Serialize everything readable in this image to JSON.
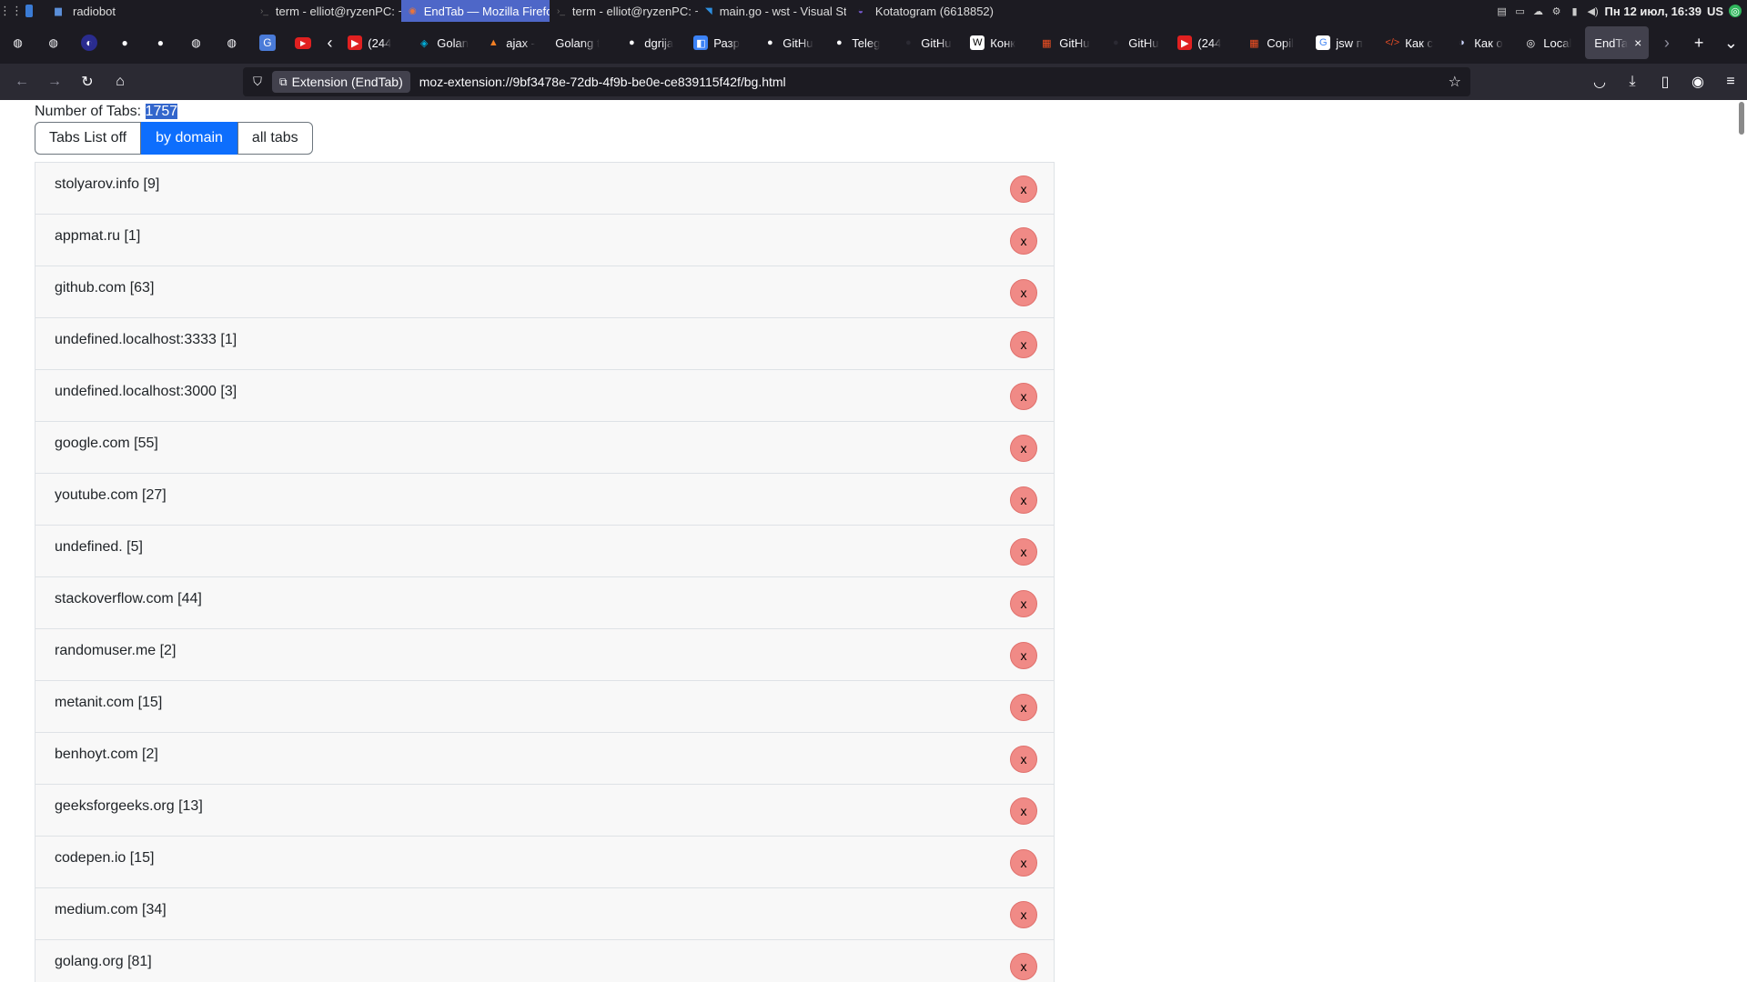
{
  "system_bar": {
    "tasks": [
      {
        "icon": "folder-icon",
        "label": "radiobot",
        "active": false
      },
      {
        "icon": "terminal-icon",
        "label": "term - elliot@ryzenPC: ~",
        "active": false
      },
      {
        "icon": "firefox-icon",
        "label": "EndTab — Mozilla Firefox",
        "active": true
      },
      {
        "icon": "terminal-icon",
        "label": "term - elliot@ryzenPC: ~",
        "active": false
      },
      {
        "icon": "vscode-icon",
        "label": "main.go - wst - Visual Stu...",
        "active": false
      },
      {
        "icon": "kotatogram-icon",
        "label": "Kotatogram (6618852)",
        "active": false
      }
    ],
    "clock": "Пн 12 июл, 16:39",
    "keyboard_layout": "US"
  },
  "browser": {
    "tabs": [
      {
        "label": "(244",
        "icon": "youtube-icon"
      },
      {
        "label": "Golan",
        "icon": "golang-icon"
      },
      {
        "label": "ajax -",
        "icon": "ajax-icon"
      },
      {
        "label": "Golang t",
        "icon": "blank-icon"
      },
      {
        "label": "dgrija",
        "icon": "github-icon"
      },
      {
        "label": "Разр",
        "icon": "puzzle-icon"
      },
      {
        "label": "GitHu",
        "icon": "github-icon"
      },
      {
        "label": "Teleg",
        "icon": "github-icon"
      },
      {
        "label": "GitHu",
        "icon": "github-dark-icon"
      },
      {
        "label": "Конк",
        "icon": "wikipedia-icon"
      },
      {
        "label": "GitHu",
        "icon": "microsoft-icon"
      },
      {
        "label": "GitHu",
        "icon": "github-dark-icon"
      },
      {
        "label": "(244",
        "icon": "youtube-icon"
      },
      {
        "label": "Copil",
        "icon": "microsoft-icon"
      },
      {
        "label": "jsw п",
        "icon": "google-icon"
      },
      {
        "label": "Как с",
        "icon": "code-icon"
      },
      {
        "label": "Как о",
        "icon": "moon-icon"
      },
      {
        "label": "Local",
        "icon": "radar-icon"
      },
      {
        "label": "EndTa",
        "icon": "blank-icon",
        "selected": true
      }
    ],
    "identity_label": "Extension (EndTab)",
    "url": "moz-extension://9bf3478e-72db-4f9b-be0e-ce839115f42f/bg.html"
  },
  "page": {
    "count_label": "Number of Tabs:",
    "count_value": "1757",
    "buttons": {
      "list_off": "Tabs List off",
      "by_domain": "by domain",
      "all_tabs": "all tabs"
    },
    "close_label": "x",
    "domains": [
      "stolyarov.info [9]",
      "appmat.ru [1]",
      "github.com [63]",
      "undefined.localhost:3333 [1]",
      "undefined.localhost:3000 [3]",
      "google.com [55]",
      "youtube.com [27]",
      "undefined. [5]",
      "stackoverflow.com [44]",
      "randomuser.me [2]",
      "metanit.com [15]",
      "benhoyt.com [2]",
      "geeksforgeeks.org [13]",
      "codepen.io [15]",
      "medium.com [34]",
      "golang.org [81]"
    ]
  },
  "colors": {
    "accent": "#0d6efd",
    "close_button": "#f08a86",
    "row_bg": "#f8f8f8",
    "selection": "#3366cc"
  }
}
